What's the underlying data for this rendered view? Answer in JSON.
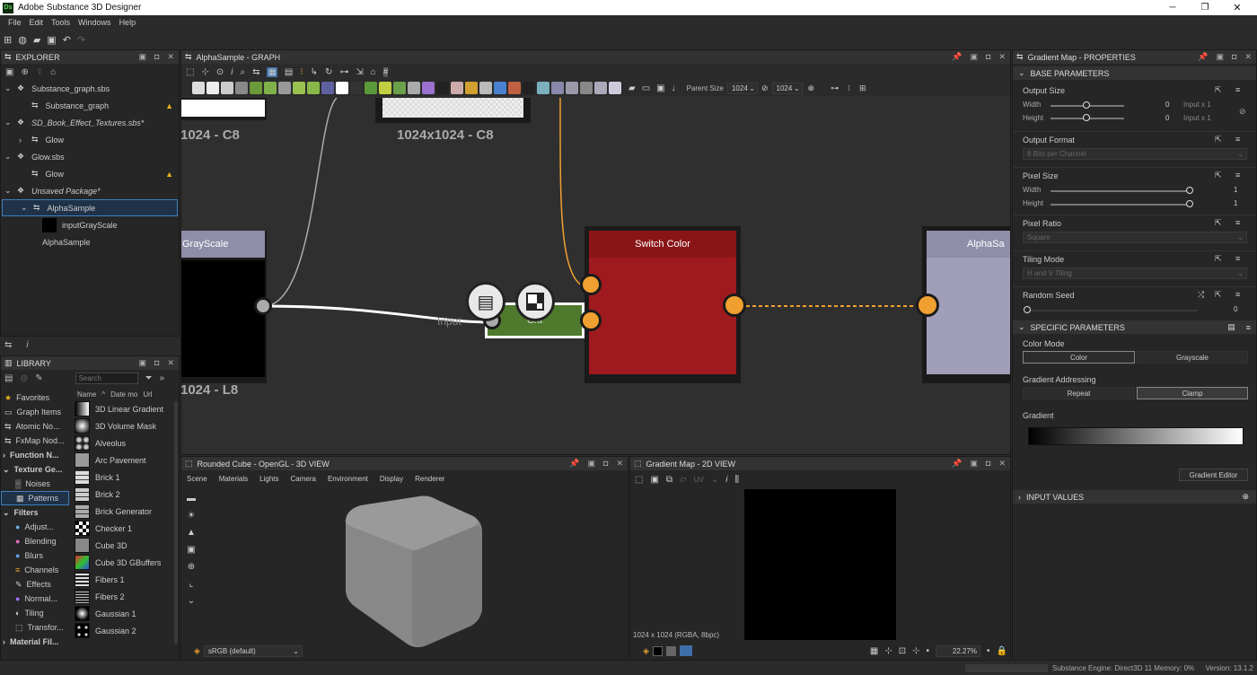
{
  "window": {
    "title": "Adobe Substance 3D Designer",
    "app_icon": "Ds"
  },
  "menu": [
    "File",
    "Edit",
    "Tools",
    "Windows",
    "Help"
  ],
  "explorer": {
    "title": "EXPLORER",
    "items": [
      {
        "label": "Substance_graph.sbs",
        "italic": false,
        "warn": false
      },
      {
        "label": "Substance_graph",
        "italic": false,
        "warn": true
      },
      {
        "label": "SD_Book_Effect_Textures.sbs*",
        "italic": true,
        "warn": false
      },
      {
        "label": "Glow",
        "italic": false,
        "warn": false
      },
      {
        "label": "Glow.sbs",
        "italic": false,
        "warn": false
      },
      {
        "label": "Glow",
        "italic": false,
        "warn": true
      },
      {
        "label": "Unsaved Package*",
        "italic": true,
        "warn": false
      },
      {
        "label": "AlphaSample",
        "italic": false,
        "warn": false
      },
      {
        "label": "inputGrayScale",
        "italic": false,
        "warn": false
      },
      {
        "label": "AlphaSample",
        "italic": false,
        "warn": false
      }
    ]
  },
  "library": {
    "title": "LIBRARY",
    "search_placeholder": "Search",
    "columns": [
      "Name",
      "Date mo",
      "Url"
    ],
    "categories": [
      "Favorites",
      "Graph Items",
      "Atomic No...",
      "FxMap Nod...",
      "Function N...",
      "Texture Ge...",
      "Noises",
      "Patterns",
      "Filters",
      "Adjust...",
      "Blending",
      "Blurs",
      "Channels",
      "Effects",
      "Normal...",
      "Tiling",
      "Transfor...",
      "Material Fil..."
    ],
    "items": [
      "3D Linear Gradient",
      "3D Volume Mask",
      "Alveolus",
      "Arc Pavement",
      "Brick 1",
      "Brick 2",
      "Brick Generator",
      "Checker 1",
      "Cube 3D",
      "Cube 3D GBuffers",
      "Fibers 1",
      "Fibers 2",
      "Gaussian 1",
      "Gaussian 2"
    ]
  },
  "graph": {
    "title": "AlphaSample - GRAPH",
    "parent_size_label": "Parent Size",
    "parent_size_w": "1024",
    "parent_size_h": "1024",
    "node_res_1": "1024 - C8",
    "node_res_2": "1024x1024 - C8",
    "node_res_3": "1024 - L8",
    "node_grayscale": "GrayScale",
    "node_switch": "Switch Color",
    "node_alpha": "AlphaSa",
    "node_gra": "Gra",
    "input_label": "Input",
    "colors": {
      "switch": "#9e1a1e",
      "switch_header": "#8a1519",
      "alpha": "#8f8ea8",
      "gra": "#4f7a2e",
      "wire_orange": "#f0a030"
    }
  },
  "view3d": {
    "title": "Rounded Cube - OpenGL - 3D VIEW",
    "menu": [
      "Scene",
      "Materials",
      "Lights",
      "Camera",
      "Environment",
      "Display",
      "Renderer"
    ],
    "colorspace": "sRGB (default)"
  },
  "view2d": {
    "title": "Gradient Map - 2D VIEW",
    "uv": "UV",
    "info": "1024 x 1024 (RGBA, 8bpc)",
    "zoom": "22.27%"
  },
  "properties": {
    "title": "Gradient Map - PROPERTIES",
    "base_section": "BASE PARAMETERS",
    "output_size": {
      "label": "Output Size",
      "width_label": "Width",
      "height_label": "Height",
      "width_value": "0",
      "height_value": "0",
      "width_rel": "Input x 1",
      "height_rel": "Input x 1"
    },
    "output_format": {
      "label": "Output Format",
      "value": "8 Bits per Channel"
    },
    "pixel_size": {
      "label": "Pixel Size",
      "width_label": "Width",
      "height_label": "Height",
      "width_value": "1",
      "height_value": "1"
    },
    "pixel_ratio": {
      "label": "Pixel Ratio",
      "value": "Square"
    },
    "tiling_mode": {
      "label": "Tiling Mode",
      "value": "H and V Tiling"
    },
    "random_seed": {
      "label": "Random Seed",
      "value": "0"
    },
    "specific_section": "SPECIFIC PARAMETERS",
    "color_mode": {
      "label": "Color Mode",
      "options": [
        "Color",
        "Grayscale"
      ],
      "selected": "Color"
    },
    "gradient_addressing": {
      "label": "Gradient Addressing",
      "options": [
        "Repeat",
        "Clamp"
      ],
      "selected": "Clamp"
    },
    "gradient": {
      "label": "Gradient",
      "editor_button": "Gradient Editor"
    },
    "input_values": "INPUT VALUES"
  },
  "status": {
    "engine": "Substance Engine: Direct3D 11  Memory: 0%",
    "version": "Version: 13.1.2"
  }
}
